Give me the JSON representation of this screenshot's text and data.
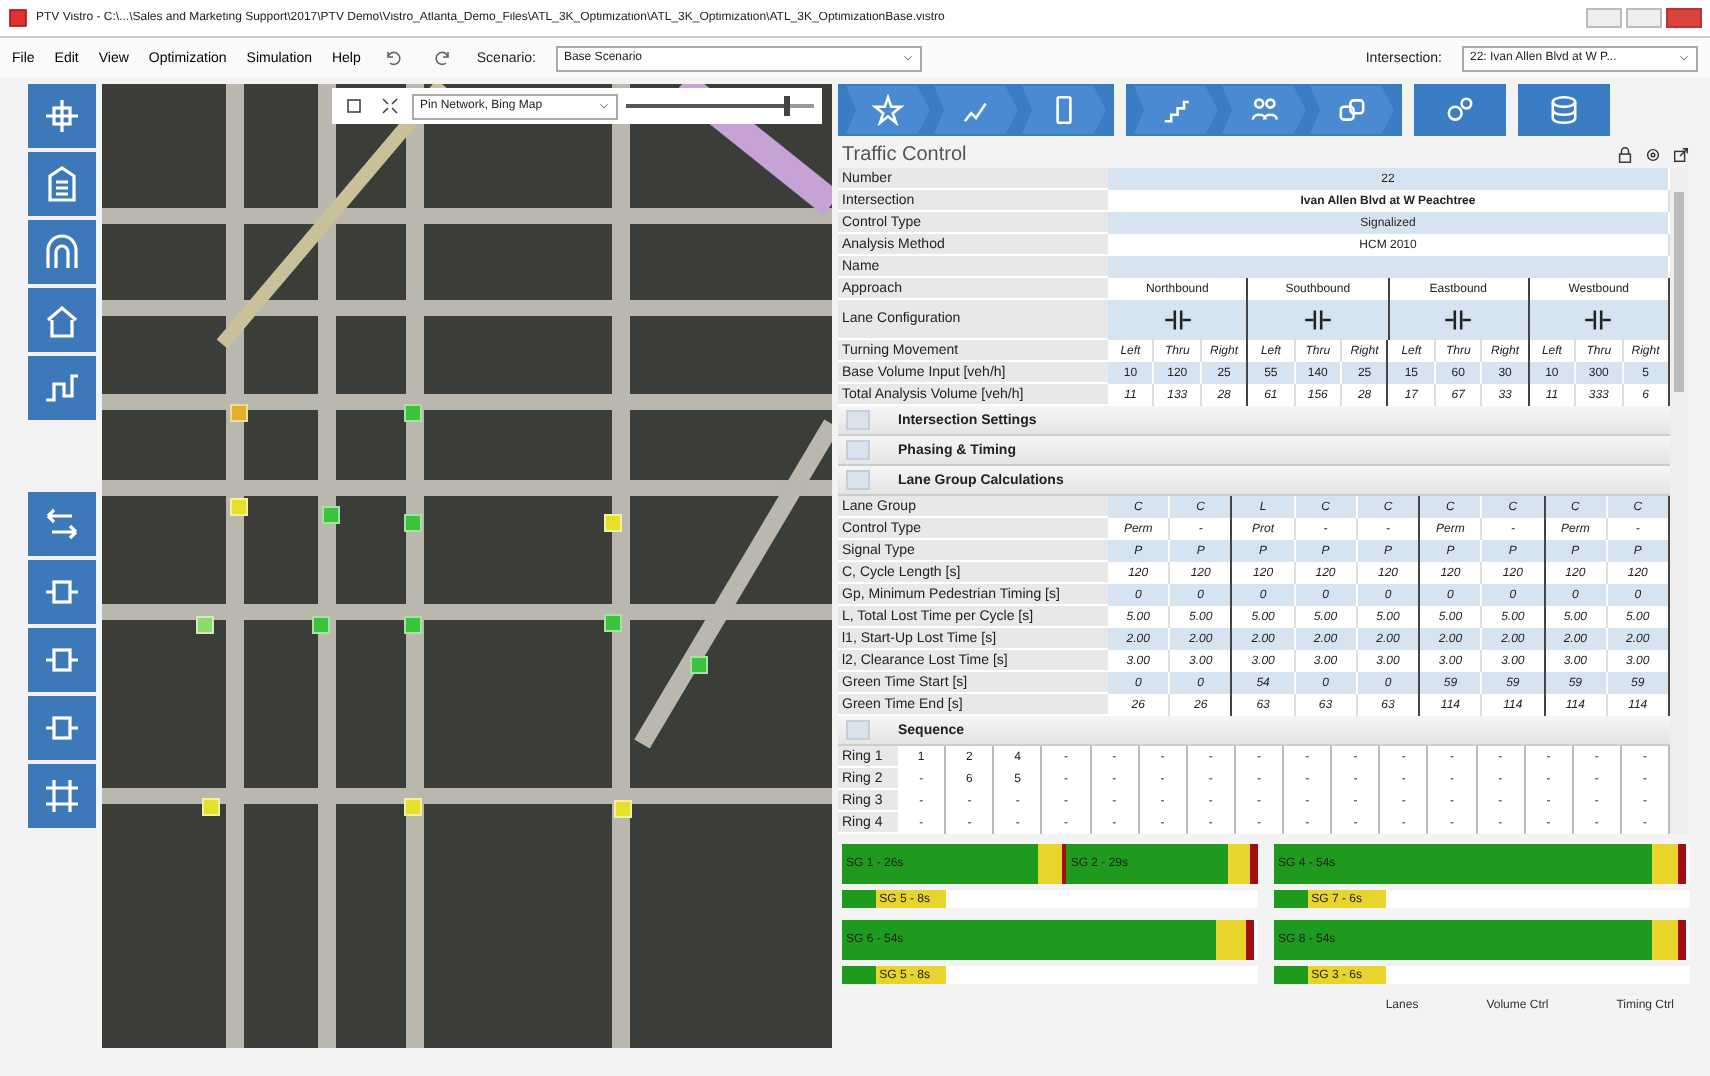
{
  "window": {
    "title": "PTV Vistro - C:\\...\\Sales and Marketing Support\\2017\\PTV Demo\\Vistro_Atlanta_Demo_Files\\ATL_3K_Optimization\\ATL_3K_Optimization\\ATL_3K_OptimizationBase.vistro"
  },
  "menu": [
    "File",
    "Edit",
    "View",
    "Optimization",
    "Simulation",
    "Help"
  ],
  "scenario": {
    "label": "Scenario:",
    "value": "Base Scenario"
  },
  "intersection_picker": {
    "label": "Intersection:",
    "value": "22: Ivan Allen Blvd at W P..."
  },
  "map": {
    "layer_select": "Pin Network, Bing Map",
    "zoom_slider": {
      "level": 0.85
    },
    "markers": [
      {
        "color": "#e0b02a"
      },
      {
        "color": "#3cc33c"
      },
      {
        "color": "#e6e02a"
      },
      {
        "color": "#3cc33c"
      },
      {
        "color": "#3cc33c"
      },
      {
        "color": "#e6e02a"
      },
      {
        "color": "#8fd86a"
      },
      {
        "color": "#3cc33c"
      },
      {
        "color": "#3cc33c"
      },
      {
        "color": "#3cc33c"
      },
      {
        "color": "#3cc33c"
      },
      {
        "color": "#e6e02a"
      },
      {
        "color": "#e6e02a"
      },
      {
        "color": "#e6e02a"
      }
    ]
  },
  "traffic_control": {
    "title": "Traffic Control",
    "info_rows": [
      {
        "label": "Number",
        "value": "22"
      },
      {
        "label": "Intersection",
        "value": "Ivan Allen Blvd at W Peachtree"
      },
      {
        "label": "Control Type",
        "value": "Signalized"
      },
      {
        "label": "Analysis Method",
        "value": "HCM 2010"
      },
      {
        "label": "Name",
        "value": ""
      }
    ],
    "approach": {
      "label": "Approach",
      "values": [
        "Northbound",
        "Southbound",
        "Eastbound",
        "Westbound"
      ]
    },
    "lane_configuration": {
      "label": "Lane Configuration"
    },
    "turning_movement": {
      "label": "Turning Movement",
      "values": [
        "Left",
        "Thru",
        "Right",
        "Left",
        "Thru",
        "Right",
        "Left",
        "Thru",
        "Right",
        "Left",
        "Thru",
        "Right"
      ]
    },
    "volume_rows": [
      {
        "label": "Base Volume Input [veh/h]",
        "values": [
          "10",
          "120",
          "25",
          "55",
          "140",
          "25",
          "15",
          "60",
          "30",
          "10",
          "300",
          "5"
        ]
      },
      {
        "label": "Total Analysis Volume [veh/h]",
        "values": [
          "11",
          "133",
          "28",
          "61",
          "156",
          "28",
          "17",
          "67",
          "33",
          "11",
          "333",
          "6"
        ]
      }
    ],
    "sections": [
      {
        "label": "Intersection Settings"
      },
      {
        "label": "Phasing & Timing"
      },
      {
        "label": "Lane Group Calculations"
      }
    ],
    "lane_group_rows": [
      {
        "label": "Lane Group",
        "values": [
          "C",
          "C",
          "L",
          "C",
          "C",
          "C",
          "C",
          "C",
          "C"
        ]
      },
      {
        "label": "Control Type",
        "values": [
          "Perm",
          "-",
          "Prot",
          "-",
          "-",
          "Perm",
          "-",
          "Perm",
          "-"
        ]
      },
      {
        "label": "Signal Type",
        "values": [
          "P",
          "P",
          "P",
          "P",
          "P",
          "P",
          "P",
          "P",
          "P"
        ]
      },
      {
        "label": "C, Cycle Length [s]",
        "values": [
          "120",
          "120",
          "120",
          "120",
          "120",
          "120",
          "120",
          "120",
          "120"
        ]
      },
      {
        "label": "Gp, Minimum Pedestrian Timing [s]",
        "values": [
          "0",
          "0",
          "0",
          "0",
          "0",
          "0",
          "0",
          "0",
          "0"
        ]
      },
      {
        "label": "L, Total Lost Time per Cycle [s]",
        "values": [
          "5.00",
          "5.00",
          "5.00",
          "5.00",
          "5.00",
          "5.00",
          "5.00",
          "5.00",
          "5.00"
        ]
      },
      {
        "label": "l1, Start-Up Lost Time [s]",
        "values": [
          "2.00",
          "2.00",
          "2.00",
          "2.00",
          "2.00",
          "2.00",
          "2.00",
          "2.00",
          "2.00"
        ]
      },
      {
        "label": "l2, Clearance Lost Time [s]",
        "values": [
          "3.00",
          "3.00",
          "3.00",
          "3.00",
          "3.00",
          "3.00",
          "3.00",
          "3.00",
          "3.00"
        ]
      },
      {
        "label": "Green Time Start [s]",
        "values": [
          "0",
          "0",
          "54",
          "0",
          "0",
          "59",
          "59",
          "59",
          "59"
        ]
      },
      {
        "label": "Green Time End [s]",
        "values": [
          "26",
          "26",
          "63",
          "63",
          "63",
          "114",
          "114",
          "114",
          "114"
        ]
      }
    ],
    "sequence": {
      "label": "Sequence",
      "rings": [
        {
          "label": "Ring 1",
          "values": [
            "1",
            "2",
            "4",
            "-",
            "-",
            "-",
            "-",
            "-",
            "-",
            "-",
            "-",
            "-",
            "-",
            "-",
            "-",
            "-"
          ]
        },
        {
          "label": "Ring 2",
          "values": [
            "-",
            "6",
            "5",
            "-",
            "-",
            "-",
            "-",
            "-",
            "-",
            "-",
            "-",
            "-",
            "-",
            "-",
            "-",
            "-"
          ]
        },
        {
          "label": "Ring 3",
          "values": [
            "-",
            "-",
            "-",
            "-",
            "-",
            "-",
            "-",
            "-",
            "-",
            "-",
            "-",
            "-",
            "-",
            "-",
            "-",
            "-"
          ]
        },
        {
          "label": "Ring 4",
          "values": [
            "-",
            "-",
            "-",
            "-",
            "-",
            "-",
            "-",
            "-",
            "-",
            "-",
            "-",
            "-",
            "-",
            "-",
            "-",
            "-"
          ]
        }
      ]
    }
  },
  "timing_panels": [
    {
      "bars": [
        {
          "kind": "main",
          "segments": [
            {
              "kind": "green",
              "level": 0.47,
              "label": "SG 1 - 26s"
            },
            {
              "kind": "yellow",
              "level": 0.06
            },
            {
              "kind": "red",
              "level": 0.01
            },
            {
              "kind": "green",
              "level": 0.39,
              "label": "SG 2 - 29s"
            },
            {
              "kind": "yellow",
              "level": 0.05
            },
            {
              "kind": "red",
              "level": 0.02
            }
          ]
        },
        {
          "kind": "minor",
          "segments": [
            {
              "kind": "green",
              "level": 0.08
            },
            {
              "kind": "yellow",
              "level": 0.17,
              "label": "SG 5 - 8s"
            }
          ]
        },
        {
          "kind": "main",
          "segments": [
            {
              "kind": "green",
              "level": 0.9,
              "label": "SG 6 - 54s"
            },
            {
              "kind": "yellow",
              "level": 0.07
            },
            {
              "kind": "red",
              "level": 0.02
            }
          ]
        },
        {
          "kind": "minor",
          "segments": [
            {
              "kind": "green",
              "level": 0.08
            },
            {
              "kind": "yellow",
              "level": 0.17,
              "label": "SG 5 - 8s"
            }
          ]
        }
      ]
    },
    {
      "bars": [
        {
          "kind": "main",
          "segments": [
            {
              "kind": "green",
              "level": 0.91,
              "label": "SG 4 - 54s"
            },
            {
              "kind": "yellow",
              "level": 0.06
            },
            {
              "kind": "red",
              "level": 0.02
            }
          ]
        },
        {
          "kind": "minor",
          "segments": [
            {
              "kind": "green",
              "level": 0.08
            },
            {
              "kind": "yellow",
              "level": 0.19,
              "label": "SG 7 - 6s"
            }
          ]
        },
        {
          "kind": "main",
          "segments": [
            {
              "kind": "green",
              "level": 0.91,
              "label": "SG 8 - 54s"
            },
            {
              "kind": "yellow",
              "level": 0.06
            },
            {
              "kind": "red",
              "level": 0.02
            }
          ]
        },
        {
          "kind": "minor",
          "segments": [
            {
              "kind": "green",
              "level": 0.08
            },
            {
              "kind": "yellow",
              "level": 0.19,
              "label": "SG 3 - 6s"
            }
          ]
        }
      ]
    }
  ],
  "footer_buttons": [
    "Lanes",
    "Volume Ctrl",
    "Timing Ctrl"
  ]
}
